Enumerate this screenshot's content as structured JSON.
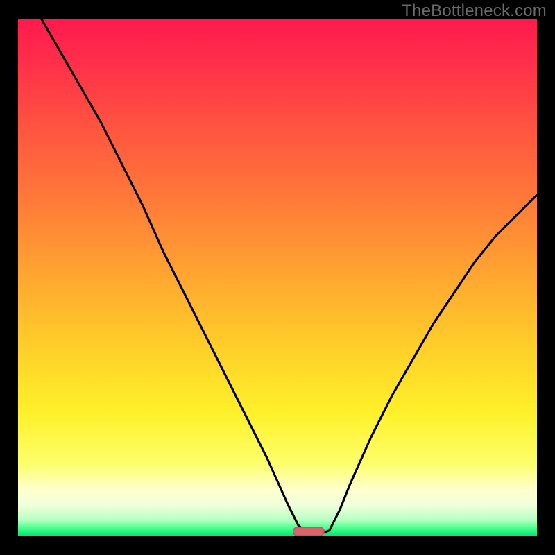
{
  "watermark": "TheBottleneck.com",
  "colors": {
    "frame_bg": "#000000",
    "watermark_text": "#6a6a6a",
    "gradient_stops": [
      {
        "offset": 0.0,
        "color": "#ff1a4d"
      },
      {
        "offset": 0.08,
        "color": "#ff2e4a"
      },
      {
        "offset": 0.22,
        "color": "#ff5740"
      },
      {
        "offset": 0.36,
        "color": "#ff7d38"
      },
      {
        "offset": 0.5,
        "color": "#ffa730"
      },
      {
        "offset": 0.64,
        "color": "#ffd029"
      },
      {
        "offset": 0.76,
        "color": "#fff029"
      },
      {
        "offset": 0.86,
        "color": "#fcff6a"
      },
      {
        "offset": 0.91,
        "color": "#ffffcc"
      },
      {
        "offset": 0.94,
        "color": "#f0ffda"
      },
      {
        "offset": 0.97,
        "color": "#b8ffc3"
      },
      {
        "offset": 0.985,
        "color": "#4dff8e"
      },
      {
        "offset": 1.0,
        "color": "#00e874"
      }
    ],
    "curve": "#000000",
    "marker_fill": "#d9636b",
    "marker_stroke": "#c04752"
  },
  "chart_data": {
    "type": "line",
    "title": "",
    "xlabel": "",
    "ylabel": "",
    "xlim": [
      0,
      100
    ],
    "ylim": [
      0,
      100
    ],
    "x": [
      0,
      4,
      8,
      12,
      16,
      20,
      24,
      28,
      32,
      36,
      40,
      44,
      48,
      52,
      54,
      56,
      58,
      60,
      62,
      64,
      68,
      72,
      76,
      80,
      84,
      88,
      92,
      96,
      100
    ],
    "values": [
      108,
      101,
      94,
      87,
      80,
      72,
      64,
      55,
      47,
      39,
      31,
      23,
      15,
      6,
      2,
      0.2,
      0.2,
      1,
      5,
      10,
      19,
      27,
      34,
      41,
      47,
      53,
      58,
      62,
      66
    ],
    "notes": "y values are scaled to ylim 0-100; values above 100 extend off-plot. Minimum (valley) at x≈56-58.",
    "optimum_marker": {
      "x_center": 56,
      "width": 6,
      "y": 0.8
    }
  }
}
